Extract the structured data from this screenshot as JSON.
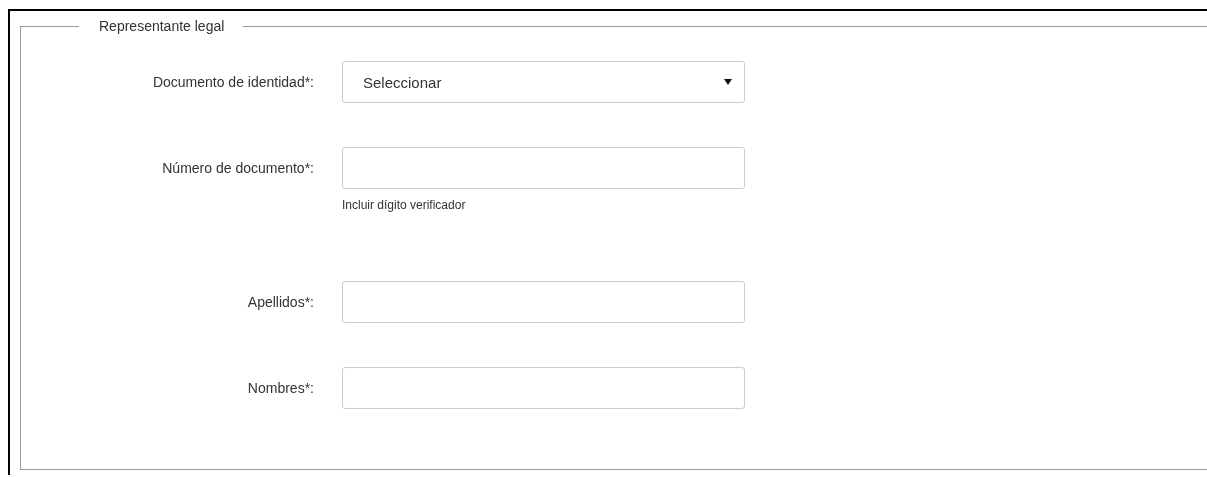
{
  "section": {
    "title": "Representante legal"
  },
  "fields": [
    {
      "kind": "select",
      "label": "Documento de identidad*:",
      "value": "Seleccionar"
    },
    {
      "kind": "text",
      "label": "Número de documento*:",
      "hint": "Incluir dígito verificador"
    },
    {
      "kind": "text",
      "label": "Apellidos*:"
    },
    {
      "kind": "text",
      "label": "Nombres*:"
    }
  ]
}
